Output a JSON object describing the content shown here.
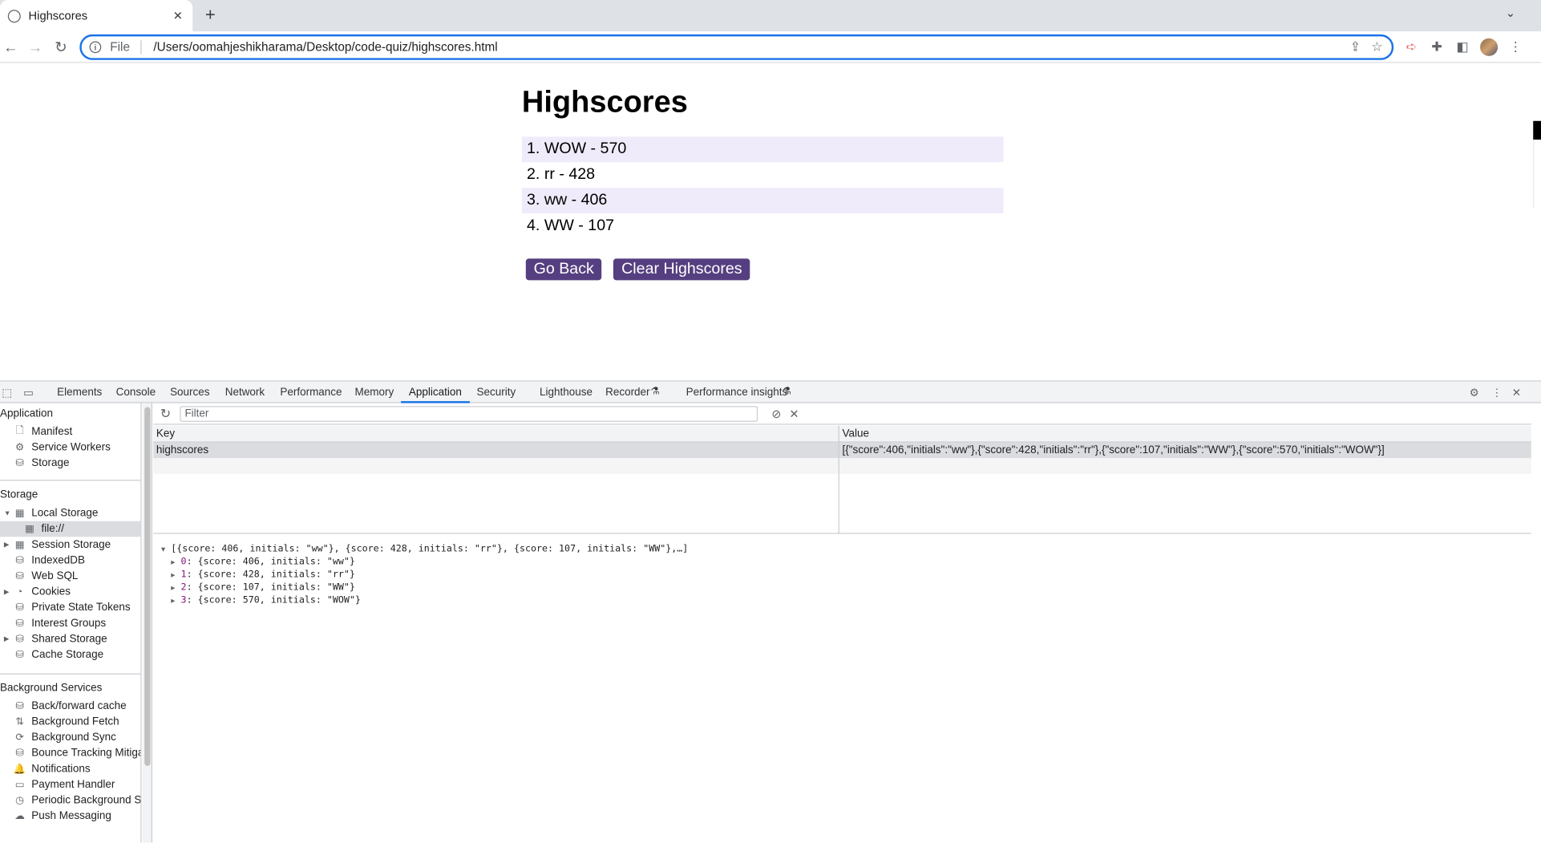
{
  "browser": {
    "tab_title": "Highscores",
    "tab_close": "✕",
    "new_tab": "+",
    "tab_menu": "⌄",
    "scheme": "File",
    "url": "/Users/oomahjeshikharama/Desktop/code-quiz/highscores.html"
  },
  "page": {
    "title": "Highscores",
    "scores": [
      "1. WOW - 570",
      "2. rr - 428",
      "3. ww - 406",
      "4. WW - 107"
    ],
    "go_back": "Go Back",
    "clear": "Clear Highscores"
  },
  "devtools": {
    "tabs": [
      "Elements",
      "Console",
      "Sources",
      "Network",
      "Performance",
      "Memory",
      "Application",
      "Security",
      "Lighthouse",
      "Recorder",
      "Performance insights"
    ],
    "active_tab": "Application",
    "sidebar": {
      "application_header": "Application",
      "application_items": [
        "Manifest",
        "Service Workers",
        "Storage"
      ],
      "storage_header": "Storage",
      "local_storage": "Local Storage",
      "local_storage_child": "file://",
      "storage_items": [
        "Session Storage",
        "IndexedDB",
        "Web SQL",
        "Cookies",
        "Private State Tokens",
        "Interest Groups",
        "Shared Storage",
        "Cache Storage"
      ],
      "background_header": "Background Services",
      "background_items": [
        "Back/forward cache",
        "Background Fetch",
        "Background Sync",
        "Bounce Tracking Mitigatic",
        "Notifications",
        "Payment Handler",
        "Periodic Background Syn",
        "Push Messaging"
      ]
    },
    "filter_placeholder": "Filter",
    "grid": {
      "key_header": "Key",
      "value_header": "Value",
      "row_key": "highscores",
      "row_value": "[{\"score\":406,\"initials\":\"ww\"},{\"score\":428,\"initials\":\"rr\"},{\"score\":107,\"initials\":\"WW\"},{\"score\":570,\"initials\":\"WOW\"}]"
    },
    "preview": {
      "summary": "[{score: 406, initials: \"ww\"}, {score: 428, initials: \"rr\"}, {score: 107, initials: \"WW\"},…]",
      "items": [
        {
          "idx": "0",
          "text": "{score: 406, initials: \"ww\"}"
        },
        {
          "idx": "1",
          "text": "{score: 428, initials: \"rr\"}"
        },
        {
          "idx": "2",
          "text": "{score: 107, initials: \"WW\"}"
        },
        {
          "idx": "3",
          "text": "{score: 570, initials: \"WOW\"}"
        }
      ]
    }
  }
}
